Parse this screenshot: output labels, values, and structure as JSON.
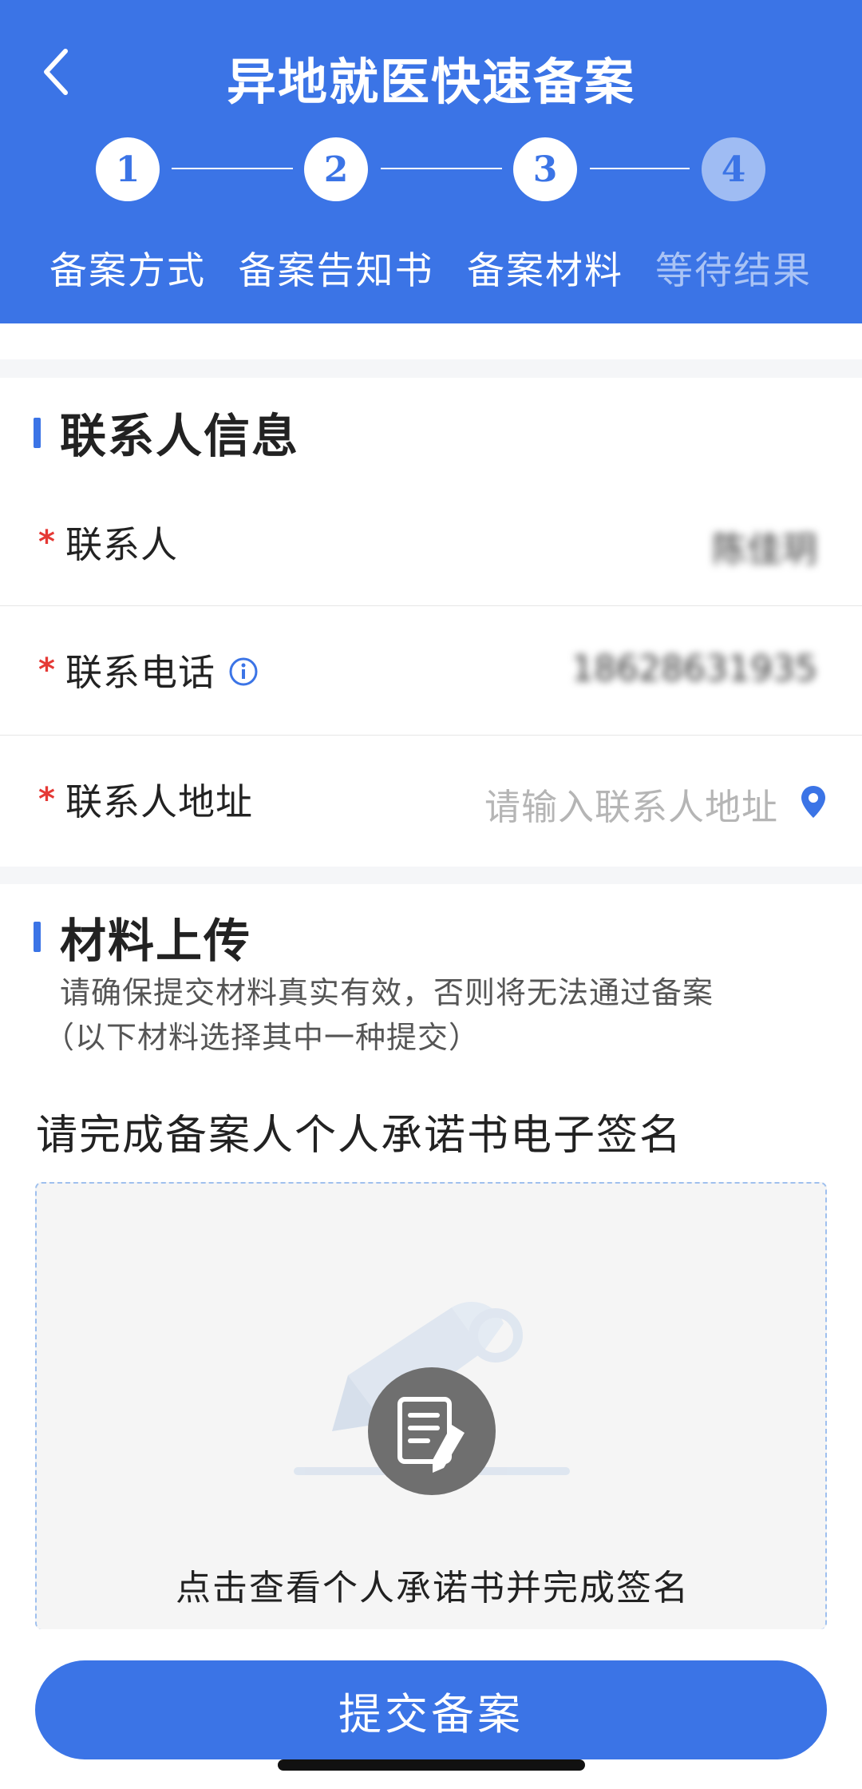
{
  "header": {
    "title": "异地就医快速备案"
  },
  "steps": [
    {
      "number": "1",
      "label": "备案方式",
      "state": "done"
    },
    {
      "number": "2",
      "label": "备案告知书",
      "state": "done"
    },
    {
      "number": "3",
      "label": "备案材料",
      "state": "current"
    },
    {
      "number": "4",
      "label": "等待结果",
      "state": "pending"
    }
  ],
  "contact": {
    "section_title": "联系人信息",
    "required_mark": "*",
    "name_label": "联系人",
    "name_value": "陈佳玥",
    "phone_label": "联系电话",
    "phone_value": "18628631935",
    "address_label": "联系人地址",
    "address_placeholder": "请输入联系人地址"
  },
  "upload": {
    "section_title": "材料上传",
    "desc_line1": "请确保提交材料真实有效，否则将无法通过备案",
    "desc_line2": "（以下材料选择其中一种提交）",
    "sign_title": "请完成备案人个人承诺书电子签名",
    "sign_hint": "点击查看个人承诺书并完成签名"
  },
  "footer": {
    "submit_label": "提交备案"
  },
  "colors": {
    "primary": "#3b74e6",
    "required": "#e53935",
    "step_pending": "#9fbcf3"
  }
}
